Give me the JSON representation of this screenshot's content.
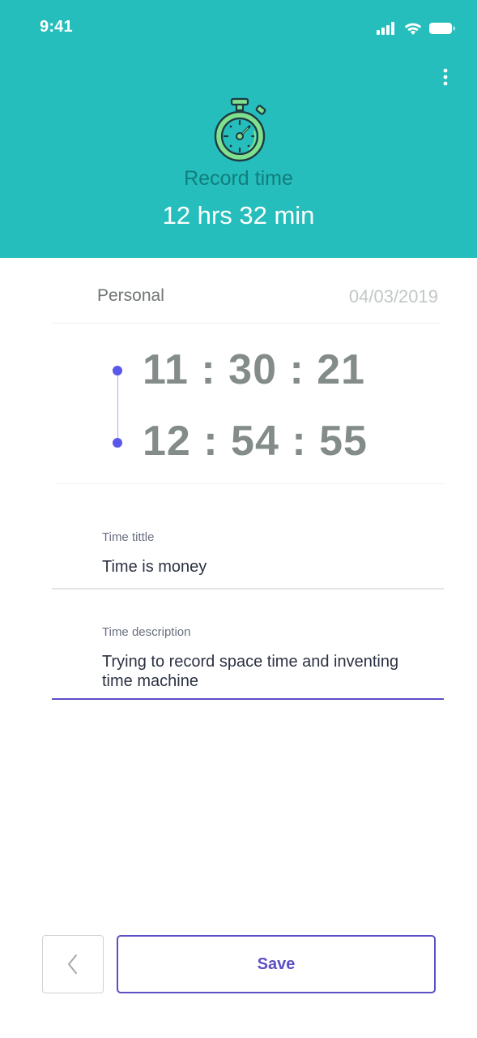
{
  "status_bar": {
    "time": "9:41",
    "icons": [
      "signal-icon",
      "wifi-icon",
      "battery-icon"
    ]
  },
  "header": {
    "icon": "stopwatch-icon",
    "menu_icon": "more-vertical-icon",
    "label": "Record time",
    "value": "12 hrs 32 min",
    "background_color": "#26bebc"
  },
  "entry": {
    "category": "Personal",
    "date": "04/03/2019",
    "start_time": "11 : 30 : 21",
    "end_time": "12 : 54 : 55"
  },
  "form": {
    "title_label": "Time tittle",
    "title_value": "Time is money",
    "description_label": "Time description",
    "description_value": "Trying to record space time and inventing time machine"
  },
  "actions": {
    "back_icon": "chevron-left-icon",
    "save_label": "Save",
    "accent_color": "#5b4fc4"
  }
}
